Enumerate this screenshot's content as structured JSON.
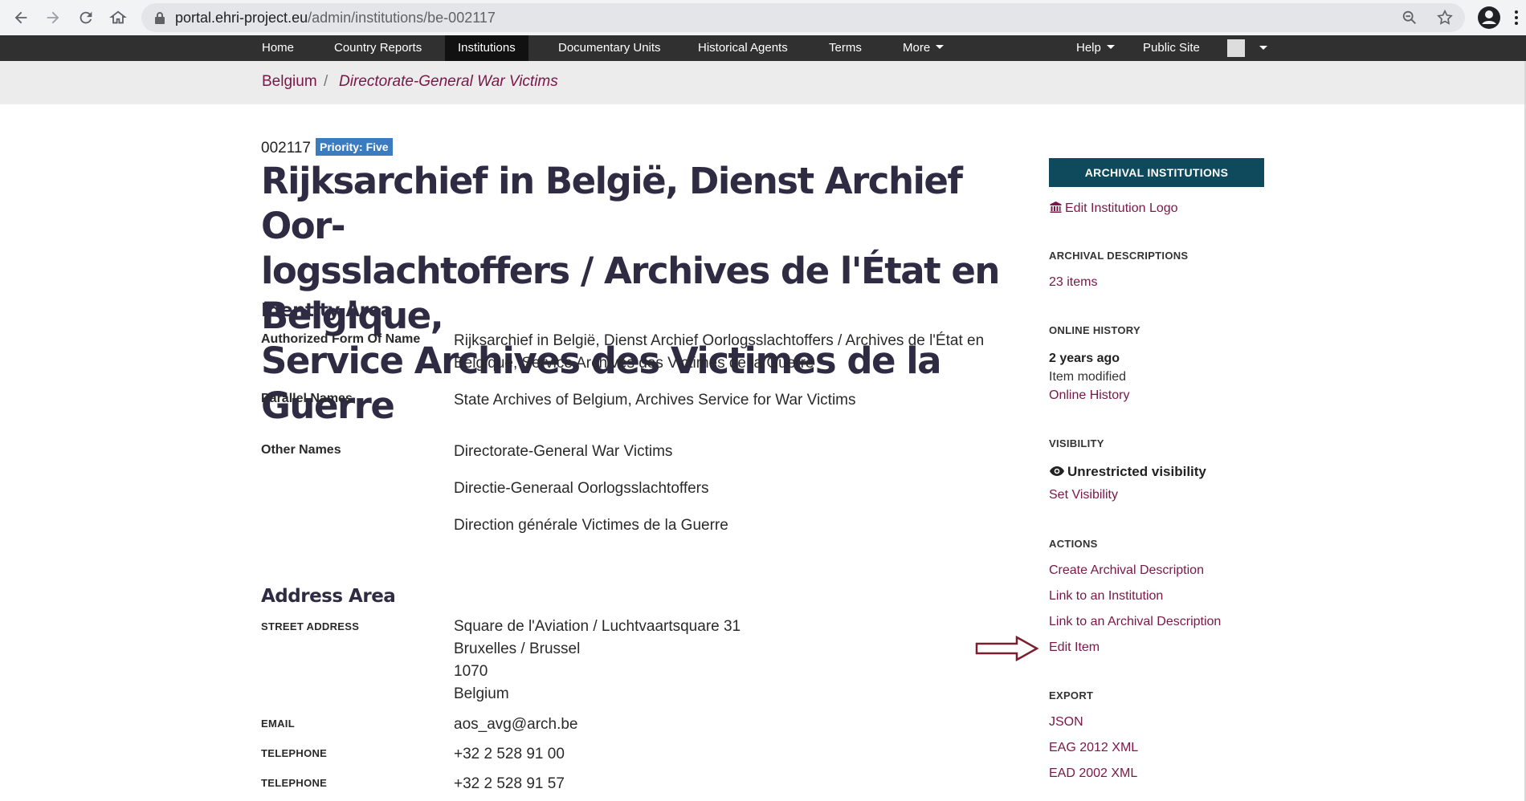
{
  "browser": {
    "url_domain": "portal.ehri-project.eu",
    "url_path": "/admin/institutions/be-002117"
  },
  "topnav": {
    "items": [
      "Home",
      "Country Reports",
      "Institutions",
      "Documentary Units",
      "Historical Agents",
      "Terms",
      "More"
    ],
    "help": "Help",
    "public_site": "Public Site"
  },
  "breadcrumb": {
    "country": "Belgium",
    "separator": "/",
    "current": "Directorate-General War Victims"
  },
  "record": {
    "id": "002117",
    "priority": "Priority: Five",
    "title": "Rijksarchief in België, Dienst Archief Oor-logsslachtoffers / Archives de l'État en Belgique, Service Archives des Victimes de la Guerre",
    "title_lines": [
      "Rijksarchief in België, Dienst Archief Oor-",
      "logsslachtoffers / Archives de l'État en Belgique,",
      "Service Archives des Victimes de la Guerre"
    ]
  },
  "identity": {
    "heading": "Identity Area",
    "authorized_label": "Authorized Form Of Name",
    "authorized_value_lines": [
      "Rijksarchief in België, Dienst Archief Oorlogsslachtoffers / Archives de l'État en",
      "Belgique, Service Archives des Victimes de la Guerre"
    ],
    "parallel_label": "Parallel Names",
    "parallel_value": "State Archives of Belgium, Archives Service for War Victims",
    "other_label": "Other Names",
    "other_values": [
      "Directorate-General War Victims",
      "Directie-Generaal Oorlogsslachtoffers",
      "Direction générale Victimes de la Guerre"
    ]
  },
  "address": {
    "heading": "Address Area",
    "street_label": "STREET ADDRESS",
    "street_lines": [
      "Square de l'Aviation / Luchtvaartsquare 31",
      "Bruxelles / Brussel",
      "1070",
      "Belgium"
    ],
    "email_label": "EMAIL",
    "email": "aos_avg@arch.be",
    "telephone_label": "TELEPHONE",
    "telephone_1": "+32 2 528 91 00",
    "telephone_2": "+32 2 528 91 57"
  },
  "sidebar": {
    "header": "ARCHIVAL INSTITUTIONS",
    "edit_logo": "Edit Institution Logo",
    "archival_descriptions_title": "ARCHIVAL DESCRIPTIONS",
    "items_count": "23 items",
    "online_history_title": "ONLINE HISTORY",
    "history_time": "2 years ago",
    "history_event": "Item modified",
    "history_link": "Online History",
    "visibility_title": "VISIBILITY",
    "visibility_value": "Unrestricted visibility",
    "set_visibility": "Set Visibility",
    "actions_title": "ACTIONS",
    "actions": [
      "Create Archival Description",
      "Link to an Institution",
      "Link to an Archival Description",
      "Edit Item"
    ],
    "export_title": "EXPORT",
    "exports": [
      "JSON",
      "EAG 2012 XML",
      "EAD 2002 XML"
    ]
  },
  "colors": {
    "link": "#7b1648",
    "navbar": "#303030",
    "sidebar_header": "#0f4a5c",
    "badge": "#3b7bbf",
    "arrow": "#7b1e2e"
  }
}
